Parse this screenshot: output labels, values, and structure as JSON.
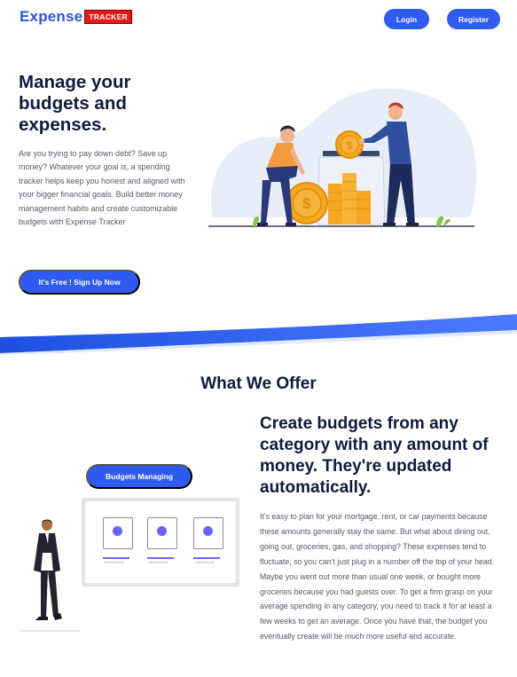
{
  "header": {
    "logo_word": "Expense",
    "logo_tag": "TRACKER",
    "login_label": "Login",
    "register_label": "Register"
  },
  "hero": {
    "title": "Manage your budgets and expenses.",
    "description": "Are you trying to pay down debt? Save up money? Whatever your goal is, a spending tracker helps keep you honest and aligned with your bigger financial goals. Build better money management habits and create customizable budgets with Expense Tracker",
    "cta_label": "It's Free ! Sign Up Now"
  },
  "offer": {
    "section_title": "What We Offer",
    "badge_label": "Budgets Managing",
    "feature_title": "Create budgets from any category with any amount of money. They're updated automatically.",
    "feature_text": "It's easy to plan for your mortgage, rent, or car payments because these amounts generally stay the same. But what about dining out, going out, groceries, gas, and shopping? These expenses tend to fluctuate, so you can't just plug in a number off the top of your head. Maybe you went out more than usual one week, or bought more groceries because you had guests over. To get a firm grasp on your average spending in any category, you need to track it for at least a few weeks to get an average. Once you have that, the budget you eventually create will be much more useful and accurate."
  },
  "colors": {
    "primary": "#2f5bf0",
    "logo_blue": "#2b54e6",
    "logo_red": "#e41b1b",
    "heading": "#0f1b3d",
    "body_text": "#555a66",
    "coin": "#f5a623",
    "accent_purple": "#6c63ff"
  },
  "icons": {
    "hero_illustration": "savings-jar-illustration",
    "person_illustration": "businessman-illustration"
  }
}
